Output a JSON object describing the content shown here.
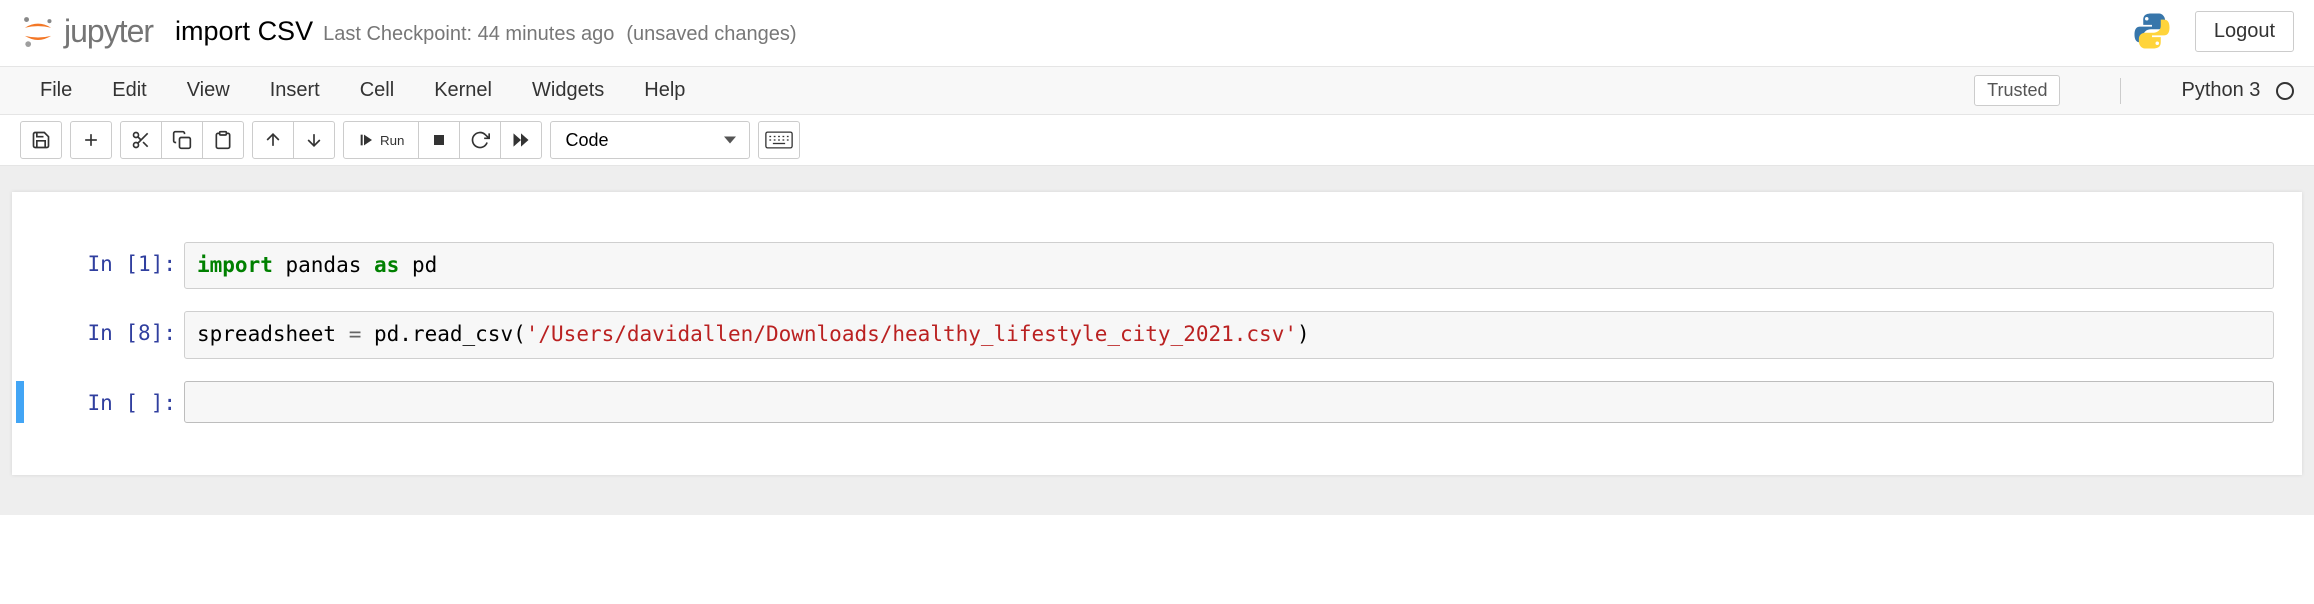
{
  "header": {
    "logo_text": "jupyter",
    "notebook_name": "import CSV",
    "checkpoint": "Last Checkpoint: 44 minutes ago",
    "unsaved": "(unsaved changes)",
    "logout": "Logout"
  },
  "menubar": {
    "items": [
      "File",
      "Edit",
      "View",
      "Insert",
      "Cell",
      "Kernel",
      "Widgets",
      "Help"
    ],
    "trusted": "Trusted",
    "kernel_name": "Python 3"
  },
  "toolbar": {
    "run_label": "Run",
    "cell_type_selected": "Code"
  },
  "cells": [
    {
      "prompt": "In [1]:",
      "code_tokens": [
        {
          "t": "import",
          "c": "kw"
        },
        {
          "t": " pandas ",
          "c": ""
        },
        {
          "t": "as",
          "c": "kw"
        },
        {
          "t": " pd",
          "c": ""
        }
      ],
      "selected": false
    },
    {
      "prompt": "In [8]:",
      "code_tokens": [
        {
          "t": "spreadsheet ",
          "c": ""
        },
        {
          "t": "=",
          "c": "op"
        },
        {
          "t": " pd.read_csv(",
          "c": ""
        },
        {
          "t": "'/Users/davidallen/Downloads/healthy_lifestyle_city_2021.csv'",
          "c": "str"
        },
        {
          "t": ")",
          "c": ""
        }
      ],
      "selected": false
    },
    {
      "prompt": "In [ ]:",
      "code_tokens": [],
      "selected": true
    }
  ]
}
